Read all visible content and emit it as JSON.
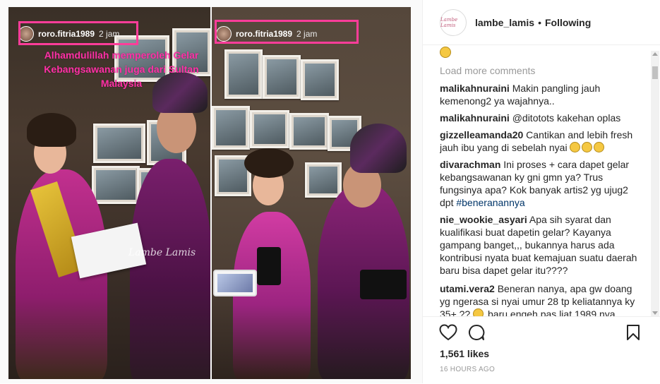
{
  "story_left": {
    "username": "roro.fitria1989",
    "time": "2 jam",
    "overlay_text": "Alhamdulillah memperoleh Gelar Kebangsawanan juga dari Sultan Malaysia",
    "watermark": "Lambe Lamis"
  },
  "story_right": {
    "username": "roro.fitria1989",
    "time": "2 jam"
  },
  "post": {
    "username": "lambe_lamis",
    "separator": "•",
    "following_label": "Following",
    "avatar_text": "Lambe Lamis",
    "load_more": "Load more comments",
    "comments": [
      {
        "user": "malikahnuraini",
        "text": "Makin pangling jauh kemenong2 ya wajahnya.."
      },
      {
        "user": "malikahnuraini",
        "text": "@ditotots kakehan oplas"
      },
      {
        "user": "gizzelleamanda20",
        "text": "Cantikan and lebih fresh jauh ibu yang di sebelah nyai"
      },
      {
        "user": "divarachman",
        "text": "Ini proses + cara dapet gelar kebangsawanan ky gni gmn ya? Trus fungsinya apa? Kok banyak artis2 yg ujug2 dpt",
        "hashtag": "#beneranannya"
      },
      {
        "user": "nie_wookie_asyari",
        "text": "Apa sih syarat dan kualifikasi buat dapetin gelar? Kayanya gampang banget,,, bukannya harus ada kontribusi nyata buat kemajuan suatu daerah baru bisa dapet gelar itu????"
      },
      {
        "user": "utami.vera2",
        "text": "Beneran nanya, apa gw doang yg ngerasa si nyai umur 28 tp keliatannya ky 35+ ??",
        "text_after": "baru engeh pas liat 1989 nya"
      }
    ],
    "likes": "1,561 likes",
    "timestamp": "16 HOURS AGO"
  },
  "colors": {
    "highlight": "#ff3d9a",
    "overlay_text": "#ff2fa6",
    "hashtag": "#003569"
  }
}
